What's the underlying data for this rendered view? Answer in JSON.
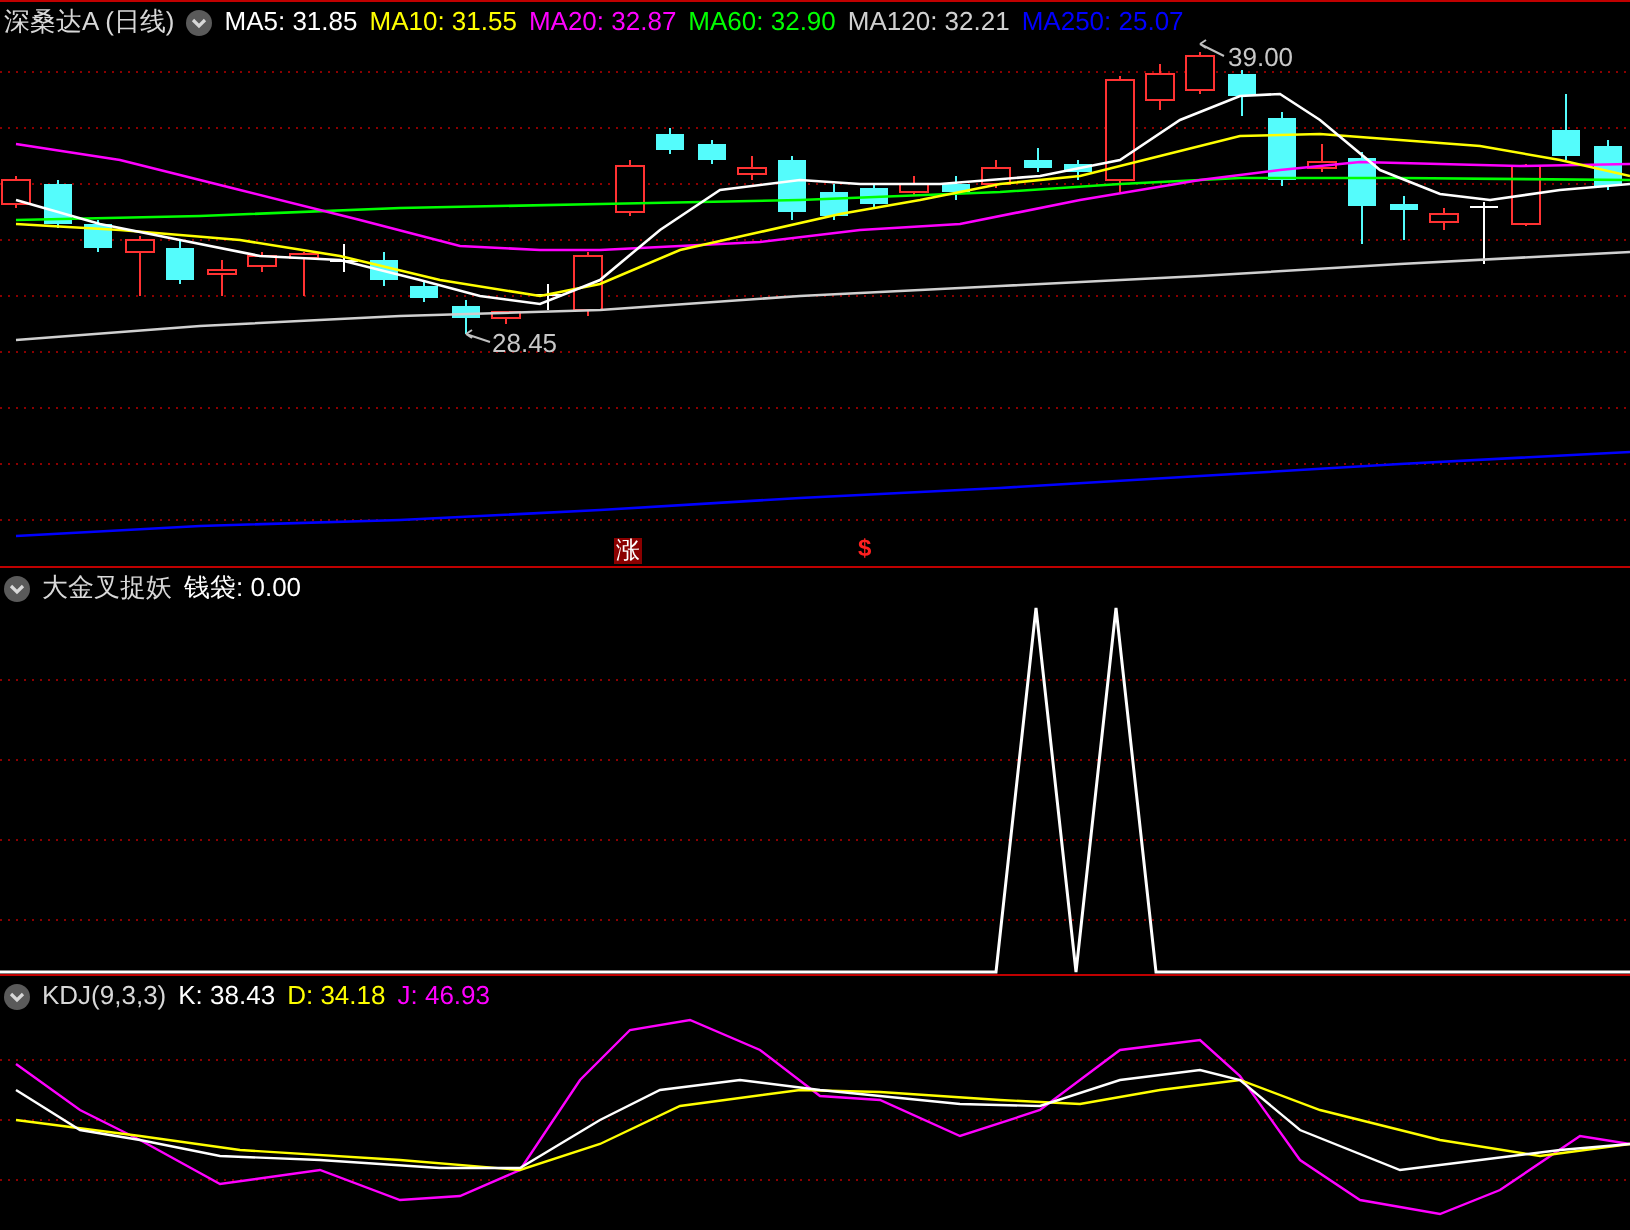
{
  "main_panel": {
    "title": "深桑达A (日线)",
    "indicators": [
      {
        "label": "MA5: 31.85",
        "color": "#ffffff"
      },
      {
        "label": "MA10: 31.55",
        "color": "#ffff00"
      },
      {
        "label": "MA20: 32.87",
        "color": "#ff00ff"
      },
      {
        "label": "MA60: 32.90",
        "color": "#00ff00"
      },
      {
        "label": "MA120: 32.21",
        "color": "#d0d0d0"
      },
      {
        "label": "MA250: 25.07",
        "color": "#0000ff"
      }
    ],
    "high_label": "39.00",
    "low_label": "28.45",
    "signals": [
      {
        "kind": "box",
        "text": "涨"
      },
      {
        "kind": "arrow",
        "text": "$"
      }
    ]
  },
  "signal_panel": {
    "title": "大金叉捉妖",
    "reading": "钱袋: 0.00"
  },
  "kdj_panel": {
    "title": "KDJ(9,3,3)",
    "indicators": [
      {
        "label": "K: 38.43",
        "color": "#ffffff"
      },
      {
        "label": "D: 34.18",
        "color": "#ffff00"
      },
      {
        "label": "J: 46.93",
        "color": "#ff00ff"
      }
    ]
  }
}
